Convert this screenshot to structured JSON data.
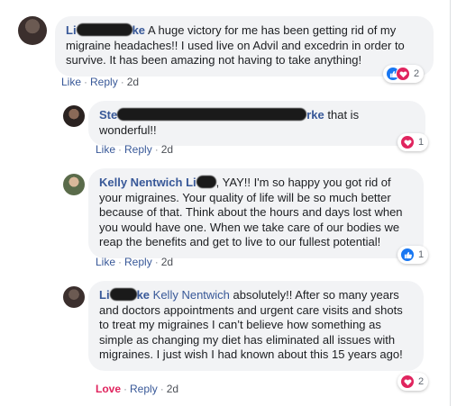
{
  "colors": {
    "author": "#385898",
    "bubble": "#f2f3f5",
    "like": "#1877f2",
    "love": "#e0245e"
  },
  "comments": [
    {
      "author_visible": "Li",
      "author_suffix": "ke",
      "text": "A huge victory for me has been getting rid of my migraine headaches!! I used live on Advil and excedrin in order to survive. It has been amazing not having to take anything!",
      "actions": {
        "like": "Like",
        "reply": "Reply",
        "time": "2d"
      },
      "reactions": {
        "icons": [
          "like-icon",
          "love-icon"
        ],
        "count": "2"
      }
    },
    {
      "author_visible": "Ste",
      "author_suffix": "rke",
      "text": "that is wonderful!!",
      "actions": {
        "like": "Like",
        "reply": "Reply",
        "time": "2d"
      },
      "reactions": {
        "icons": [
          "love-icon"
        ],
        "count": "1"
      }
    },
    {
      "author": "Kelly Nentwich",
      "tag_visible": "Li",
      "text": "YAY!! I'm so happy you got rid of your migraines. Your quality of life will be so much better because of that. Think about the hours and days lost when you would have one. When we take care of our bodies we reap the benefits and get to live to our fullest potential!",
      "actions": {
        "like": "Like",
        "reply": "Reply",
        "time": "2d"
      },
      "reactions": {
        "icons": [
          "like-icon"
        ],
        "count": "1"
      }
    },
    {
      "author_visible": "Li",
      "author_suffix": "ke",
      "tag": "Kelly Nentwich",
      "text": "absolutely!! After so many years and doctors appointments and urgent care visits and shots to treat my migraines I can’t believe how something as simple as changing my diet has eliminated all issues with migraines. I just wish I had known about this 15 years ago!",
      "actions": {
        "like": "Love",
        "reply": "Reply",
        "time": "2d"
      },
      "reactions": {
        "icons": [
          "love-icon"
        ],
        "count": "2"
      }
    }
  ]
}
